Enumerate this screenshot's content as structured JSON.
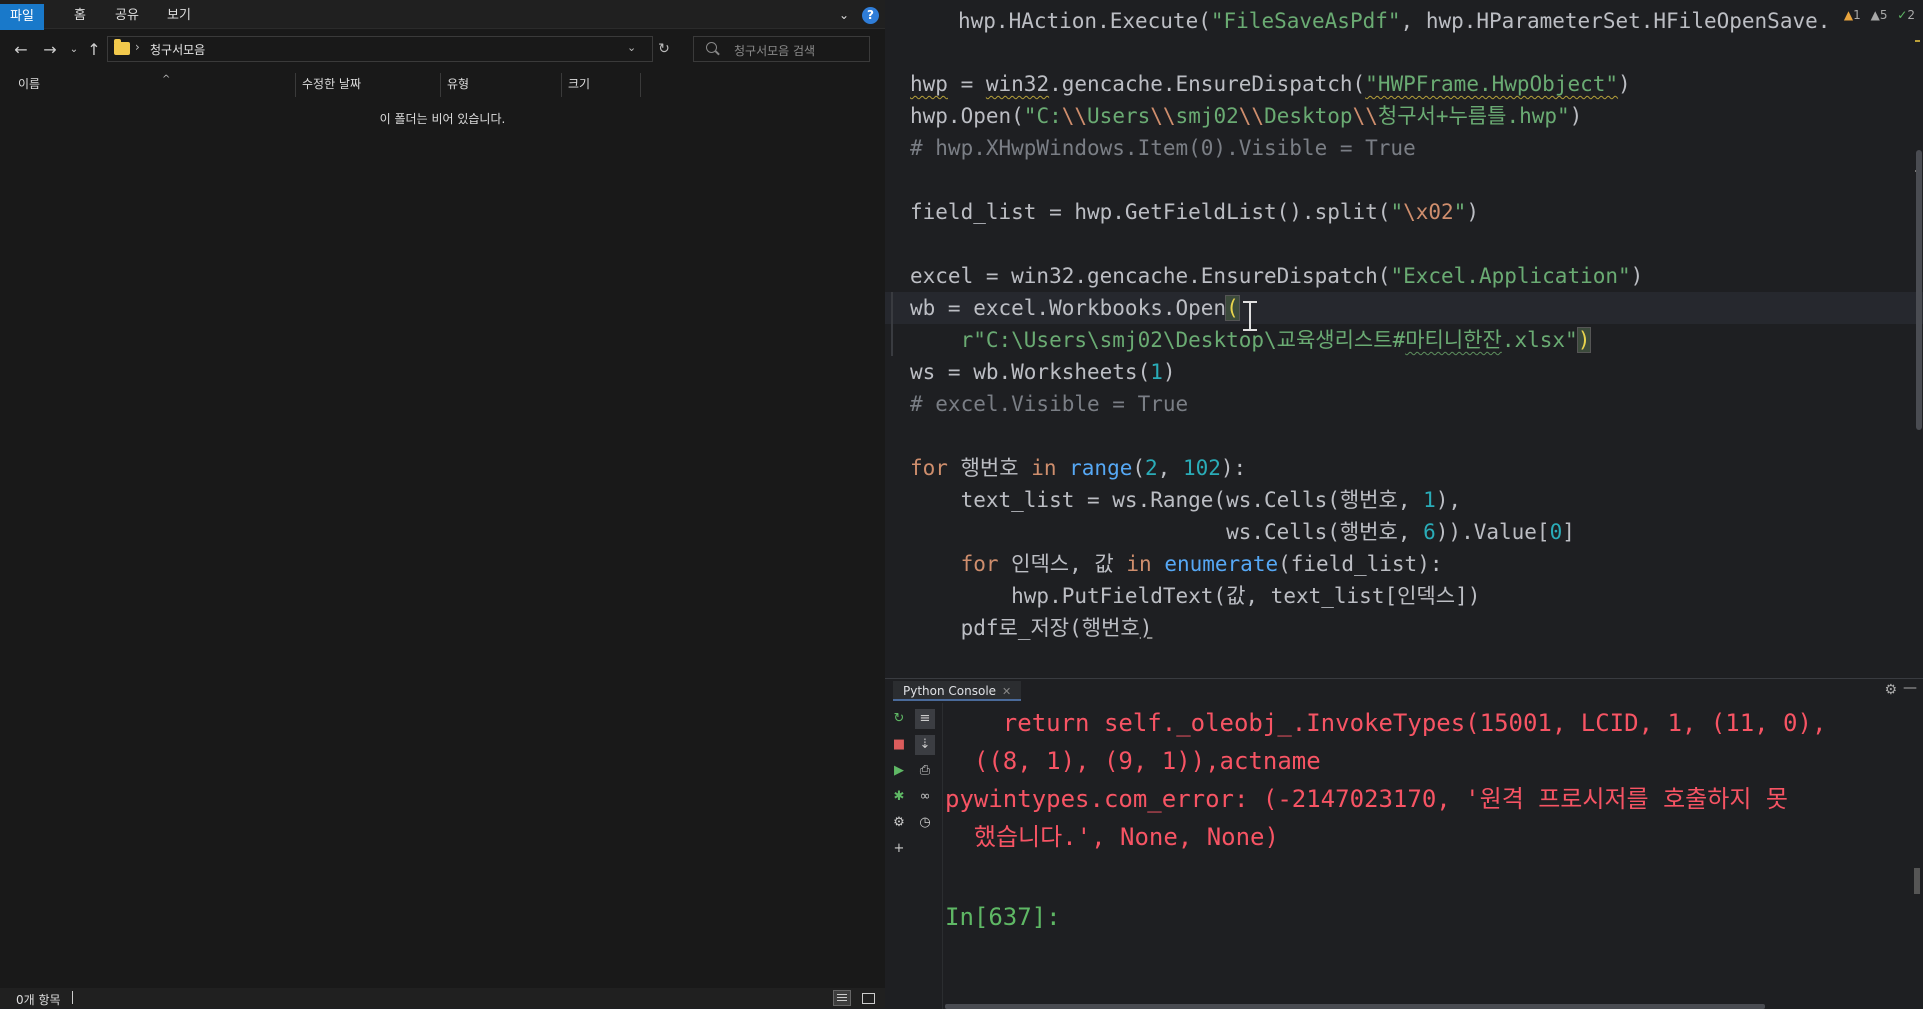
{
  "explorer": {
    "ribbon_tabs": [
      "파일",
      "홈",
      "공유",
      "보기"
    ],
    "help_label": "?",
    "address_path": "청구서모음",
    "search_placeholder": "청구서모음 검색",
    "columns": [
      "이름",
      "수정한 날짜",
      "유형",
      "크기"
    ],
    "empty_message": "이 폴더는 비어 있습니다.",
    "status_count": "0개 항목"
  },
  "editor": {
    "inspections": {
      "warnings": "1",
      "weak_warnings": "5",
      "typos": "2"
    }
  },
  "console": {
    "tab_label": "Python Console",
    "output_lines": [
      "    return self._oleobj_.InvokeTypes(15001, LCID, 1, (11, 0),",
      "  ((8, 1), (9, 1)),actname",
      "pywintypes.com_error: (-2147023170, '원격 프로시저를 호출하지 못",
      "  했습니다.', None, None)"
    ],
    "prompt": "In[637]:"
  }
}
